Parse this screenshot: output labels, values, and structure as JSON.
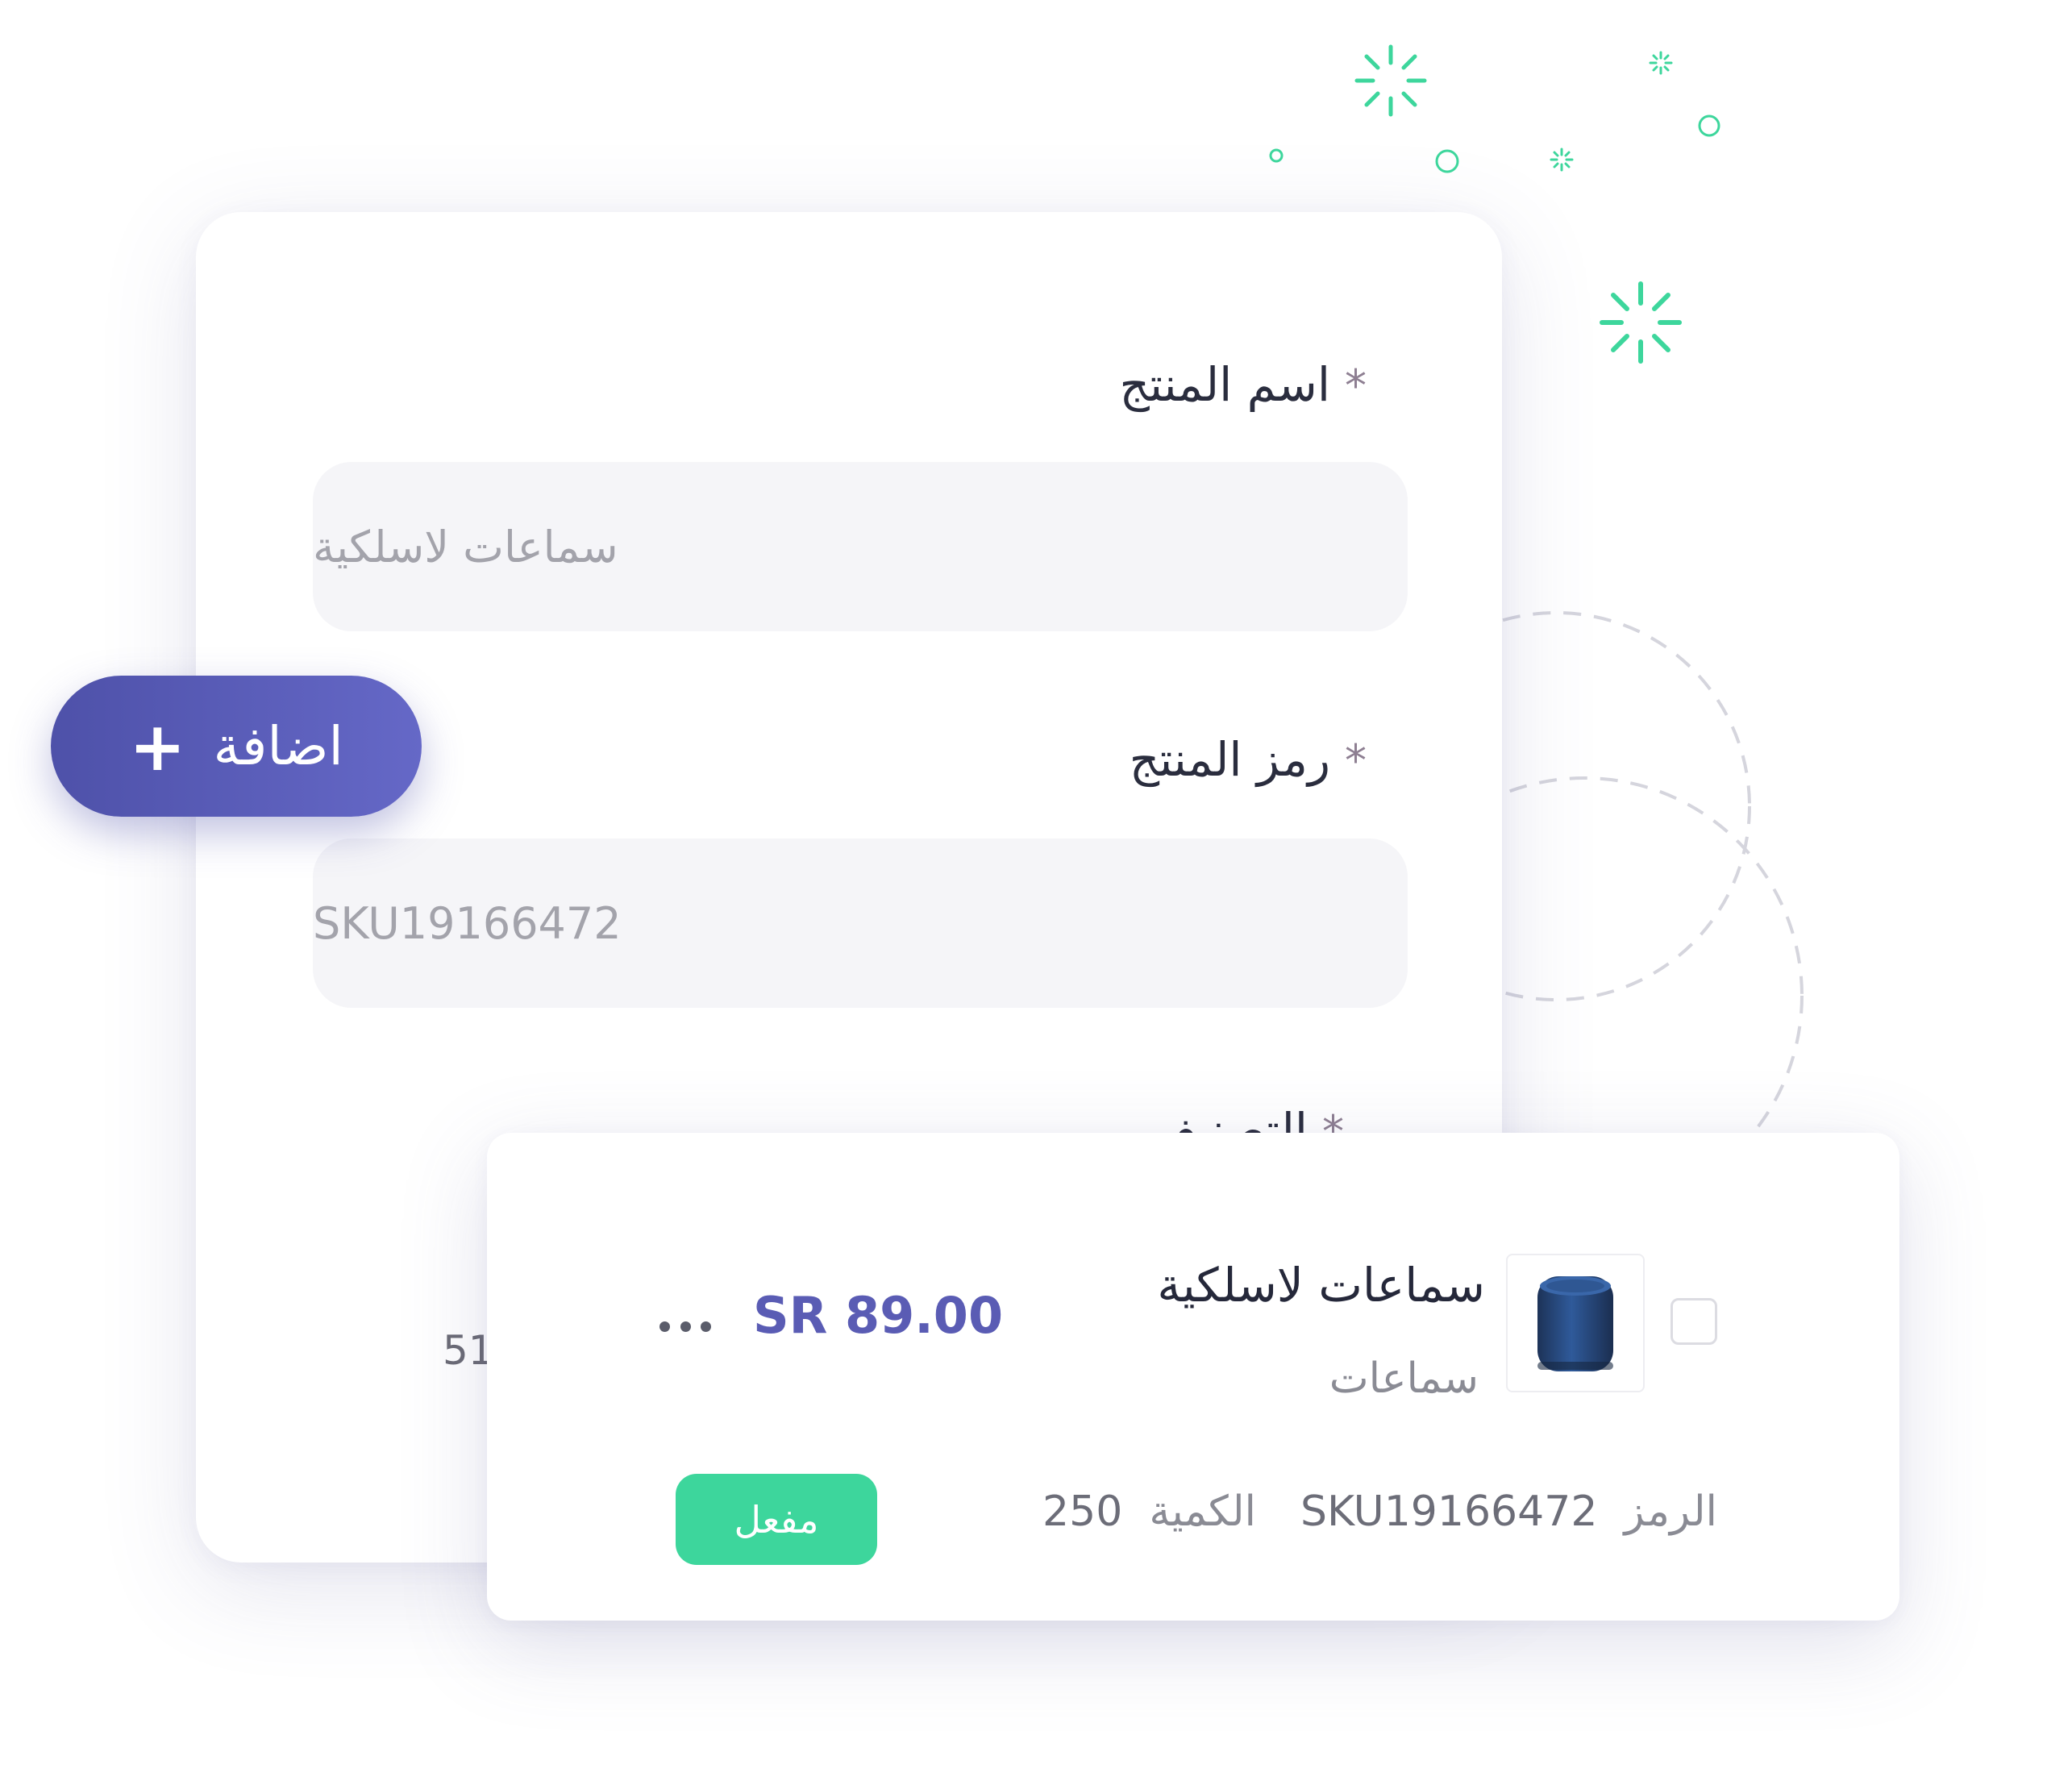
{
  "form": {
    "product_name": {
      "label": "اسم المنتج",
      "required_mark": "*",
      "value": "سماعات لاسلكية"
    },
    "product_sku": {
      "label": "رمز المنتج",
      "required_mark": "*",
      "value": "SKU19166472"
    },
    "category": {
      "label": "التصنيف",
      "required_mark": "*"
    },
    "partial_value": "51"
  },
  "add_button": {
    "label": "اضافة",
    "icon": "plus-icon"
  },
  "product_card": {
    "name": "سماعات لاسلكية",
    "category": "سماعات",
    "price": "SR 89.00",
    "more_icon": "more-dots-icon",
    "image_icon": "speaker-icon",
    "sku_label": "الرمز",
    "sku_value": "SKU19166472",
    "qty_label": "الكمية",
    "qty_value": "250",
    "status": "مفعل"
  },
  "colors": {
    "accent": "#5a5cb4",
    "button_gradient_start": "#4e51a9",
    "button_gradient_end": "#6568c7",
    "status_green": "#3dd69c",
    "sparkle_green": "#3dd69c"
  }
}
